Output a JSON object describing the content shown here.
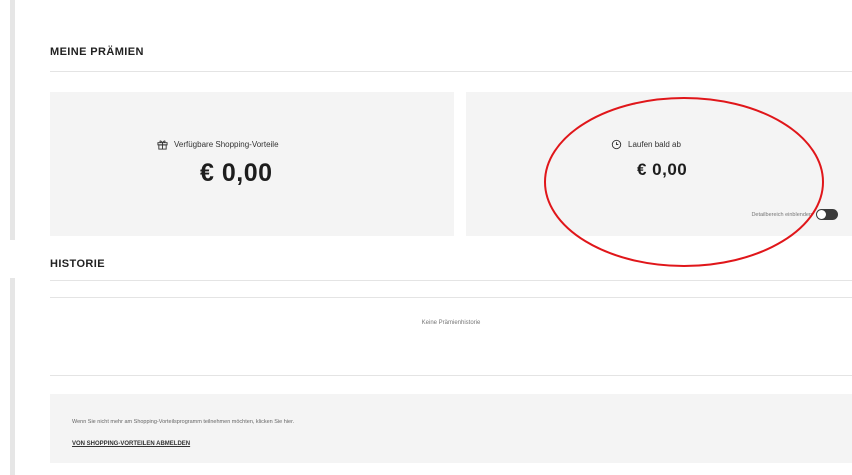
{
  "rewards": {
    "title": "MEINE PRÄMIEN",
    "available": {
      "label": "Verfügbare Shopping-Vorteile",
      "amount": "€ 0,00",
      "icon": "gift-icon"
    },
    "expiring": {
      "label": "Laufen bald ab",
      "amount": "€ 0,00",
      "icon": "clock-icon"
    },
    "toggle_label": "Detailbereich einblenden",
    "toggle_state": "on"
  },
  "history": {
    "title": "HISTORIE",
    "empty_text": "Keine Prämienhistorie"
  },
  "optout": {
    "text": "Wenn Sie nicht mehr am Shopping-Vorteilsprogramm teilnehmen möchten, klicken Sie hier.",
    "link": "VON SHOPPING-VORTEILEN ABMELDEN"
  },
  "annotation": {
    "color": "#e0161a"
  }
}
